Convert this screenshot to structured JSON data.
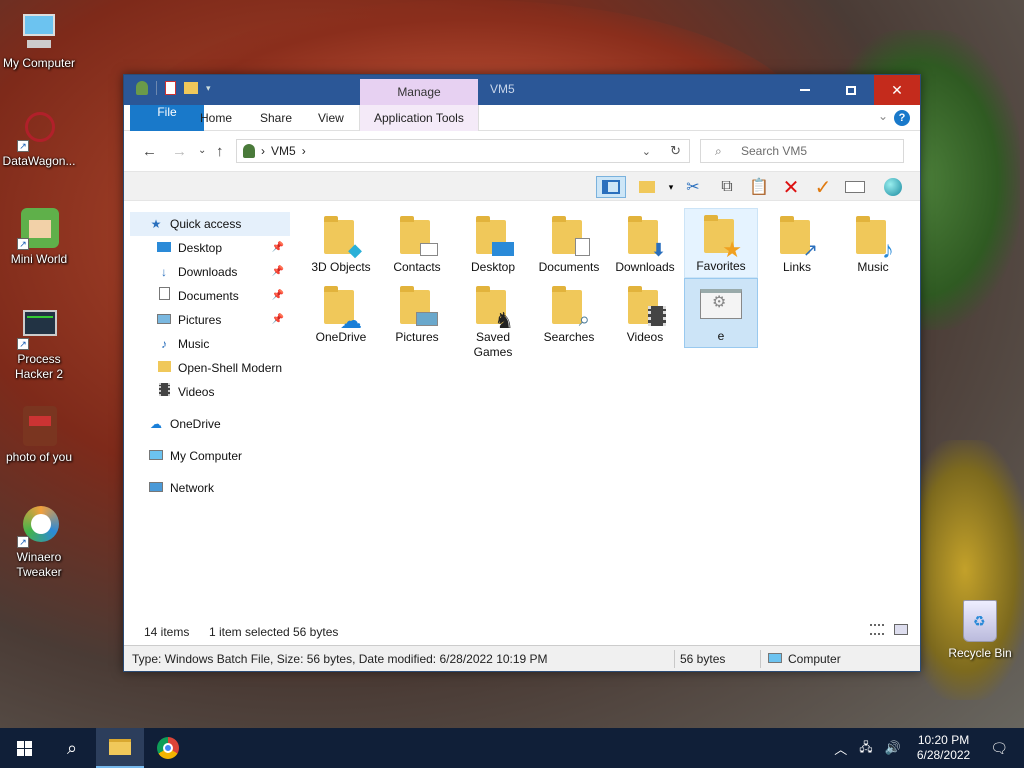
{
  "desktop": {
    "icons": [
      {
        "label": "My Computer"
      },
      {
        "label": "DataWagon..."
      },
      {
        "label": "Mini World"
      },
      {
        "label": "Process Hacker 2"
      },
      {
        "label": "photo of you"
      },
      {
        "label": "Winaero Tweaker"
      }
    ],
    "recycle_bin": "Recycle Bin"
  },
  "window": {
    "title": "VM5",
    "context_tab": "Manage",
    "ribbon_tabs": [
      "File",
      "Home",
      "Share",
      "View",
      "Application Tools"
    ],
    "breadcrumb": "VM5",
    "search_placeholder": "Search VM5",
    "nav": {
      "quick_access": "Quick access",
      "pinned": [
        "Desktop",
        "Downloads",
        "Documents",
        "Pictures"
      ],
      "unpinned": [
        "Music",
        "Open-Shell Modern",
        "Videos"
      ],
      "onedrive": "OneDrive",
      "computer": "My Computer",
      "network": "Network"
    },
    "files": [
      {
        "name": "3D Objects"
      },
      {
        "name": "Contacts"
      },
      {
        "name": "Desktop"
      },
      {
        "name": "Documents"
      },
      {
        "name": "Downloads"
      },
      {
        "name": "Favorites"
      },
      {
        "name": "Links"
      },
      {
        "name": "Music"
      },
      {
        "name": "OneDrive"
      },
      {
        "name": "Pictures"
      },
      {
        "name": "Saved Games"
      },
      {
        "name": "Searches"
      },
      {
        "name": "Videos"
      },
      {
        "name": "e"
      }
    ],
    "status": {
      "items": "14 items",
      "selected": "1 item selected",
      "size": "56 bytes"
    },
    "details_bar": {
      "info": "Type: Windows Batch File, Size: 56 bytes, Date modified: 6/28/2022 10:19 PM",
      "size": "56 bytes",
      "location": "Computer"
    }
  },
  "taskbar": {
    "time": "10:20 PM",
    "date": "6/28/2022"
  }
}
